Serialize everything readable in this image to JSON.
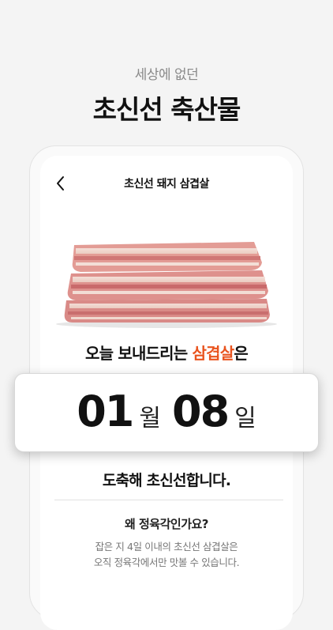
{
  "promo": {
    "subtitle": "세상에 없던",
    "title": "초신선 축산물"
  },
  "screen": {
    "nav_title": "초신선 돼지 삼겹살",
    "back_icon": "chevron-left-icon",
    "product_image": "pork-belly-image",
    "headline_prefix": "오늘 보내드리는 ",
    "headline_accent": "삼겹살",
    "headline_suffix": "은",
    "accent_color": "#e9541f",
    "delivery_date": {
      "month": "01",
      "month_unit": "월",
      "day": "08",
      "day_unit": "일"
    },
    "arrival_text": "도축해 초신선합니다.",
    "why_title": "왜 정육각인가요?",
    "why_desc_line1": "잡은 지 4일 이내의 초신선 삼겹살은",
    "why_desc_line2": "오직 정육각에서만 맛볼 수 있습니다."
  }
}
